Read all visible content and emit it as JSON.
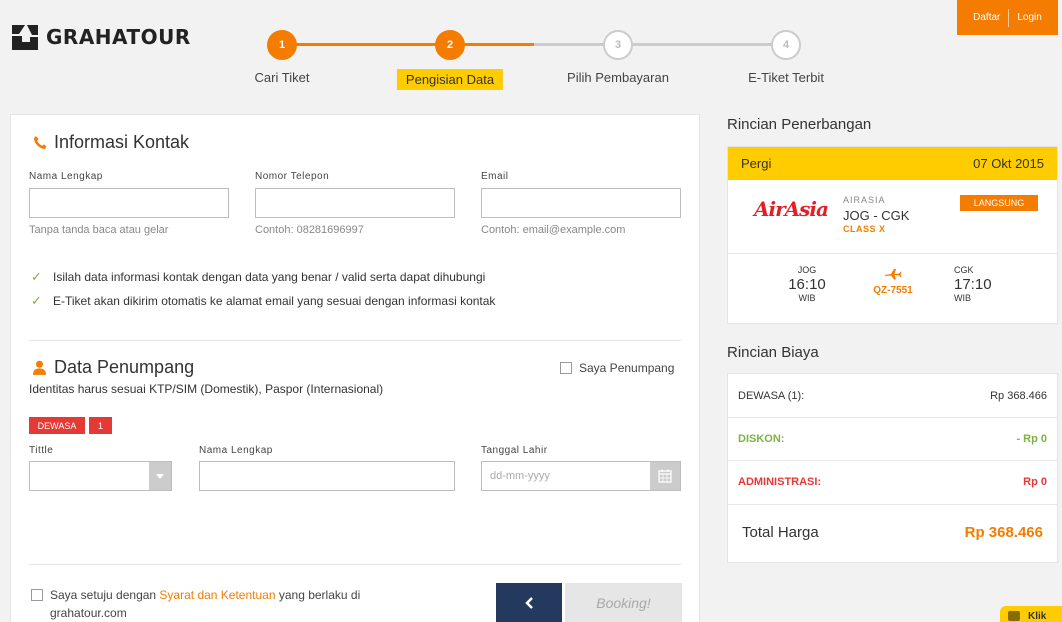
{
  "brand": {
    "name": "GRAHATOUR"
  },
  "auth": {
    "register": "Daftar",
    "login": "Login"
  },
  "steps": [
    {
      "number": "1",
      "label": "Cari Tiket",
      "state": "done"
    },
    {
      "number": "2",
      "label": "Pengisian Data",
      "state": "current"
    },
    {
      "number": "3",
      "label": "Pilih Pembayaran",
      "state": "pending"
    },
    {
      "number": "4",
      "label": "E-Tiket Terbit",
      "state": "pending"
    }
  ],
  "contact": {
    "title": "Informasi Kontak",
    "name_label": "Nama Lengkap",
    "name_hint": "Tanpa tanda baca atau gelar",
    "phone_label": "Nomor Telepon",
    "phone_hint": "Contoh: 08281696997",
    "email_label": "Email",
    "email_hint": "Contoh: email@example.com",
    "notes": [
      "Isilah data informasi kontak dengan data yang benar / valid serta dapat dihubungi",
      "E-Tiket akan dikirim otomatis ke alamat email yang sesuai dengan informasi kontak"
    ]
  },
  "passenger": {
    "title": "Data Penumpang",
    "self_checkbox": "Saya Penumpang",
    "subtitle": "Identitas harus sesuai KTP/SIM (Domestik), Paspor (Internasional)",
    "type_badge": "DEWASA",
    "count_badge": "1",
    "title_label": "Tittle",
    "name_label": "Nama Lengkap",
    "dob_label": "Tanggal Lahir",
    "dob_placeholder": "dd-mm-yyyy"
  },
  "agreement": {
    "prefix": "Saya setuju dengan ",
    "link": "Syarat dan Ketentuan",
    "suffix": " yang berlaku di",
    "line2": "grahatour.com"
  },
  "actions": {
    "back_icon": "chevron-left-icon",
    "book": "Booking!"
  },
  "flight": {
    "section_title": "Rincian Penerbangan",
    "direction": "Pergi",
    "date": "07 Okt 2015",
    "airline_logo_text": "AirAsia",
    "airline": "AIRASIA",
    "route": "JOG - CGK",
    "class": "CLASS X",
    "type_badge": "LANGSUNG",
    "dep_code": "JOG",
    "dep_time": "16:10",
    "dep_tz": "WIB",
    "flight_no": "QZ-7551",
    "arr_code": "CGK",
    "arr_time": "17:10",
    "arr_tz": "WIB"
  },
  "price": {
    "section_title": "Rincian Biaya",
    "adult_label": "DEWASA (1):",
    "adult_value": "Rp 368.466",
    "discount_label": "DISKON:",
    "discount_value": "- Rp 0",
    "admin_label": "ADMINISTRASI:",
    "admin_value": "Rp 0",
    "total_label": "Total Harga",
    "total_value": "Rp 368.466"
  },
  "chat": {
    "label": "Klik"
  },
  "colors": {
    "accent": "#f47c00",
    "highlight": "#ffcc00",
    "green": "#7cb342",
    "red": "#e53935",
    "navy": "#233a5e"
  }
}
